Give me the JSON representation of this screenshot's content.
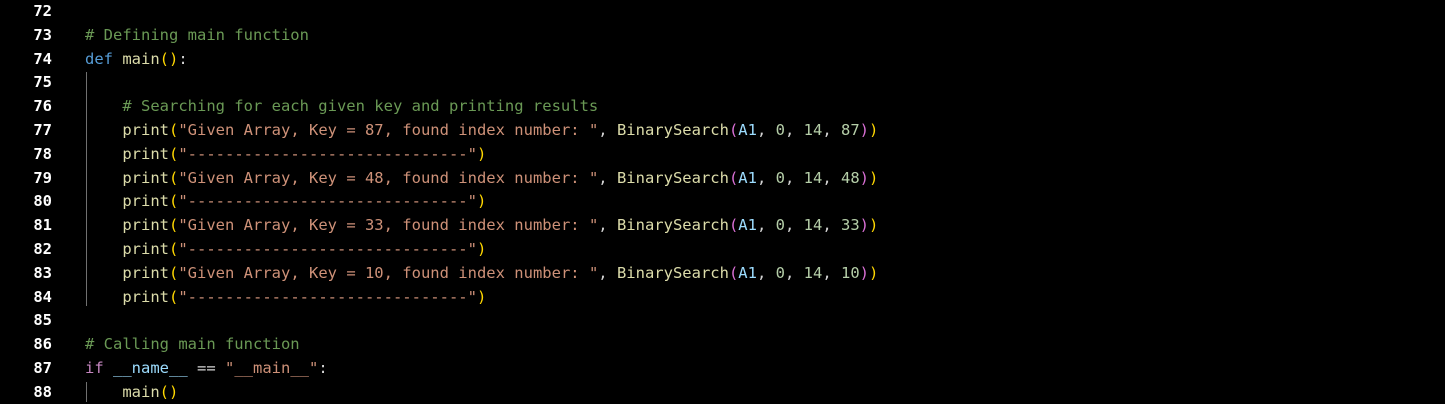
{
  "editor": {
    "colors": {
      "background": "#000000",
      "line_number": "#ffffff",
      "comment": "#6a9955",
      "keyword": "#569cd6",
      "control": "#c586c0",
      "function": "#dcdcaa",
      "string": "#ce9178",
      "number": "#b5cea8",
      "variable": "#9cdcfe",
      "plain": "#d4d4d4",
      "bracket_level_1": "#ffd700",
      "bracket_level_2": "#da70d6",
      "bracket_level_3": "#179fff"
    },
    "lines": [
      {
        "number": "72",
        "indent": "",
        "tokens": []
      },
      {
        "number": "73",
        "indent": "",
        "tokens": [
          {
            "t": "# Defining main function",
            "c": "comment"
          }
        ]
      },
      {
        "number": "74",
        "indent": "",
        "tokens": [
          {
            "t": "def",
            "c": "keyword"
          },
          {
            "t": " ",
            "c": "plain"
          },
          {
            "t": "main",
            "c": "func"
          },
          {
            "t": "()",
            "c": "b1"
          },
          {
            "t": ":",
            "c": "plain"
          }
        ]
      },
      {
        "number": "75",
        "indent": "",
        "tokens": []
      },
      {
        "number": "76",
        "indent": "    ",
        "tokens": [
          {
            "t": "# Searching for each given key and printing results",
            "c": "comment"
          }
        ]
      },
      {
        "number": "77",
        "indent": "    ",
        "tokens": [
          {
            "t": "print",
            "c": "func"
          },
          {
            "t": "(",
            "c": "b1"
          },
          {
            "t": "\"Given Array, Key = 87, found index number: \"",
            "c": "string"
          },
          {
            "t": ", ",
            "c": "plain"
          },
          {
            "t": "BinarySearch",
            "c": "func"
          },
          {
            "t": "(",
            "c": "b2"
          },
          {
            "t": "A1",
            "c": "var"
          },
          {
            "t": ", ",
            "c": "plain"
          },
          {
            "t": "0",
            "c": "number"
          },
          {
            "t": ", ",
            "c": "plain"
          },
          {
            "t": "14",
            "c": "number"
          },
          {
            "t": ", ",
            "c": "plain"
          },
          {
            "t": "87",
            "c": "number"
          },
          {
            "t": ")",
            "c": "b2"
          },
          {
            "t": ")",
            "c": "b1"
          }
        ]
      },
      {
        "number": "78",
        "indent": "    ",
        "tokens": [
          {
            "t": "print",
            "c": "func"
          },
          {
            "t": "(",
            "c": "b1"
          },
          {
            "t": "\"------------------------------\"",
            "c": "string"
          },
          {
            "t": ")",
            "c": "b1"
          }
        ]
      },
      {
        "number": "79",
        "indent": "    ",
        "tokens": [
          {
            "t": "print",
            "c": "func"
          },
          {
            "t": "(",
            "c": "b1"
          },
          {
            "t": "\"Given Array, Key = 48, found index number: \"",
            "c": "string"
          },
          {
            "t": ", ",
            "c": "plain"
          },
          {
            "t": "BinarySearch",
            "c": "func"
          },
          {
            "t": "(",
            "c": "b2"
          },
          {
            "t": "A1",
            "c": "var"
          },
          {
            "t": ", ",
            "c": "plain"
          },
          {
            "t": "0",
            "c": "number"
          },
          {
            "t": ", ",
            "c": "plain"
          },
          {
            "t": "14",
            "c": "number"
          },
          {
            "t": ", ",
            "c": "plain"
          },
          {
            "t": "48",
            "c": "number"
          },
          {
            "t": ")",
            "c": "b2"
          },
          {
            "t": ")",
            "c": "b1"
          }
        ]
      },
      {
        "number": "80",
        "indent": "    ",
        "tokens": [
          {
            "t": "print",
            "c": "func"
          },
          {
            "t": "(",
            "c": "b1"
          },
          {
            "t": "\"------------------------------\"",
            "c": "string"
          },
          {
            "t": ")",
            "c": "b1"
          }
        ]
      },
      {
        "number": "81",
        "indent": "    ",
        "tokens": [
          {
            "t": "print",
            "c": "func"
          },
          {
            "t": "(",
            "c": "b1"
          },
          {
            "t": "\"Given Array, Key = 33, found index number: \"",
            "c": "string"
          },
          {
            "t": ", ",
            "c": "plain"
          },
          {
            "t": "BinarySearch",
            "c": "func"
          },
          {
            "t": "(",
            "c": "b2"
          },
          {
            "t": "A1",
            "c": "var"
          },
          {
            "t": ", ",
            "c": "plain"
          },
          {
            "t": "0",
            "c": "number"
          },
          {
            "t": ", ",
            "c": "plain"
          },
          {
            "t": "14",
            "c": "number"
          },
          {
            "t": ", ",
            "c": "plain"
          },
          {
            "t": "33",
            "c": "number"
          },
          {
            "t": ")",
            "c": "b2"
          },
          {
            "t": ")",
            "c": "b1"
          }
        ]
      },
      {
        "number": "82",
        "indent": "    ",
        "tokens": [
          {
            "t": "print",
            "c": "func"
          },
          {
            "t": "(",
            "c": "b1"
          },
          {
            "t": "\"------------------------------\"",
            "c": "string"
          },
          {
            "t": ")",
            "c": "b1"
          }
        ]
      },
      {
        "number": "83",
        "indent": "    ",
        "tokens": [
          {
            "t": "print",
            "c": "func"
          },
          {
            "t": "(",
            "c": "b1"
          },
          {
            "t": "\"Given Array, Key = 10, found index number: \"",
            "c": "string"
          },
          {
            "t": ", ",
            "c": "plain"
          },
          {
            "t": "BinarySearch",
            "c": "func"
          },
          {
            "t": "(",
            "c": "b2"
          },
          {
            "t": "A1",
            "c": "var"
          },
          {
            "t": ", ",
            "c": "plain"
          },
          {
            "t": "0",
            "c": "number"
          },
          {
            "t": ", ",
            "c": "plain"
          },
          {
            "t": "14",
            "c": "number"
          },
          {
            "t": ", ",
            "c": "plain"
          },
          {
            "t": "10",
            "c": "number"
          },
          {
            "t": ")",
            "c": "b2"
          },
          {
            "t": ")",
            "c": "b1"
          }
        ]
      },
      {
        "number": "84",
        "indent": "    ",
        "tokens": [
          {
            "t": "print",
            "c": "func"
          },
          {
            "t": "(",
            "c": "b1"
          },
          {
            "t": "\"------------------------------\"",
            "c": "string"
          },
          {
            "t": ")",
            "c": "b1"
          }
        ]
      },
      {
        "number": "85",
        "indent": "",
        "tokens": []
      },
      {
        "number": "86",
        "indent": "",
        "tokens": [
          {
            "t": "# Calling main function",
            "c": "comment"
          }
        ]
      },
      {
        "number": "87",
        "indent": "",
        "tokens": [
          {
            "t": "if",
            "c": "control"
          },
          {
            "t": " ",
            "c": "plain"
          },
          {
            "t": "__name__",
            "c": "var"
          },
          {
            "t": " == ",
            "c": "plain"
          },
          {
            "t": "\"__main__\"",
            "c": "string"
          },
          {
            "t": ":",
            "c": "plain"
          }
        ]
      },
      {
        "number": "88",
        "indent": "    ",
        "tokens": [
          {
            "t": "main",
            "c": "func"
          },
          {
            "t": "()",
            "c": "b1"
          }
        ]
      }
    ]
  }
}
